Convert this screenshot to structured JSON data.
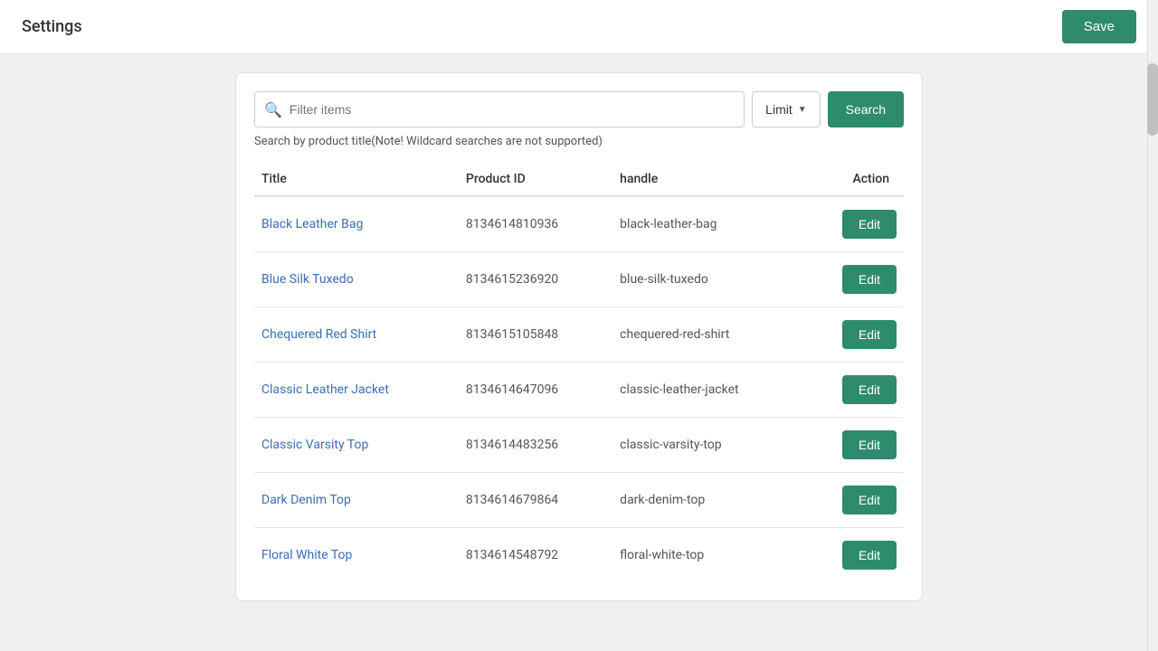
{
  "header": {
    "title": "Settings",
    "save_label": "Save"
  },
  "search": {
    "placeholder": "Filter items",
    "hint": "Search by product title(Note! Wildcard searches are not supported)",
    "limit_label": "Limit",
    "search_label": "Search"
  },
  "table": {
    "columns": [
      {
        "key": "title",
        "label": "Title"
      },
      {
        "key": "product_id",
        "label": "Product ID"
      },
      {
        "key": "handle",
        "label": "handle"
      },
      {
        "key": "action",
        "label": "Action"
      }
    ],
    "rows": [
      {
        "title": "Black Leather Bag",
        "product_id": "8134614810936",
        "handle": "black-leather-bag",
        "edit_label": "Edit"
      },
      {
        "title": "Blue Silk Tuxedo",
        "product_id": "8134615236920",
        "handle": "blue-silk-tuxedo",
        "edit_label": "Edit"
      },
      {
        "title": "Chequered Red Shirt",
        "product_id": "8134615105848",
        "handle": "chequered-red-shirt",
        "edit_label": "Edit"
      },
      {
        "title": "Classic Leather Jacket",
        "product_id": "8134614647096",
        "handle": "classic-leather-jacket",
        "edit_label": "Edit"
      },
      {
        "title": "Classic Varsity Top",
        "product_id": "8134614483256",
        "handle": "classic-varsity-top",
        "edit_label": "Edit"
      },
      {
        "title": "Dark Denim Top",
        "product_id": "8134614679864",
        "handle": "dark-denim-top",
        "edit_label": "Edit"
      },
      {
        "title": "Floral White Top",
        "product_id": "8134614548792",
        "handle": "floral-white-top",
        "edit_label": "Edit"
      }
    ]
  }
}
